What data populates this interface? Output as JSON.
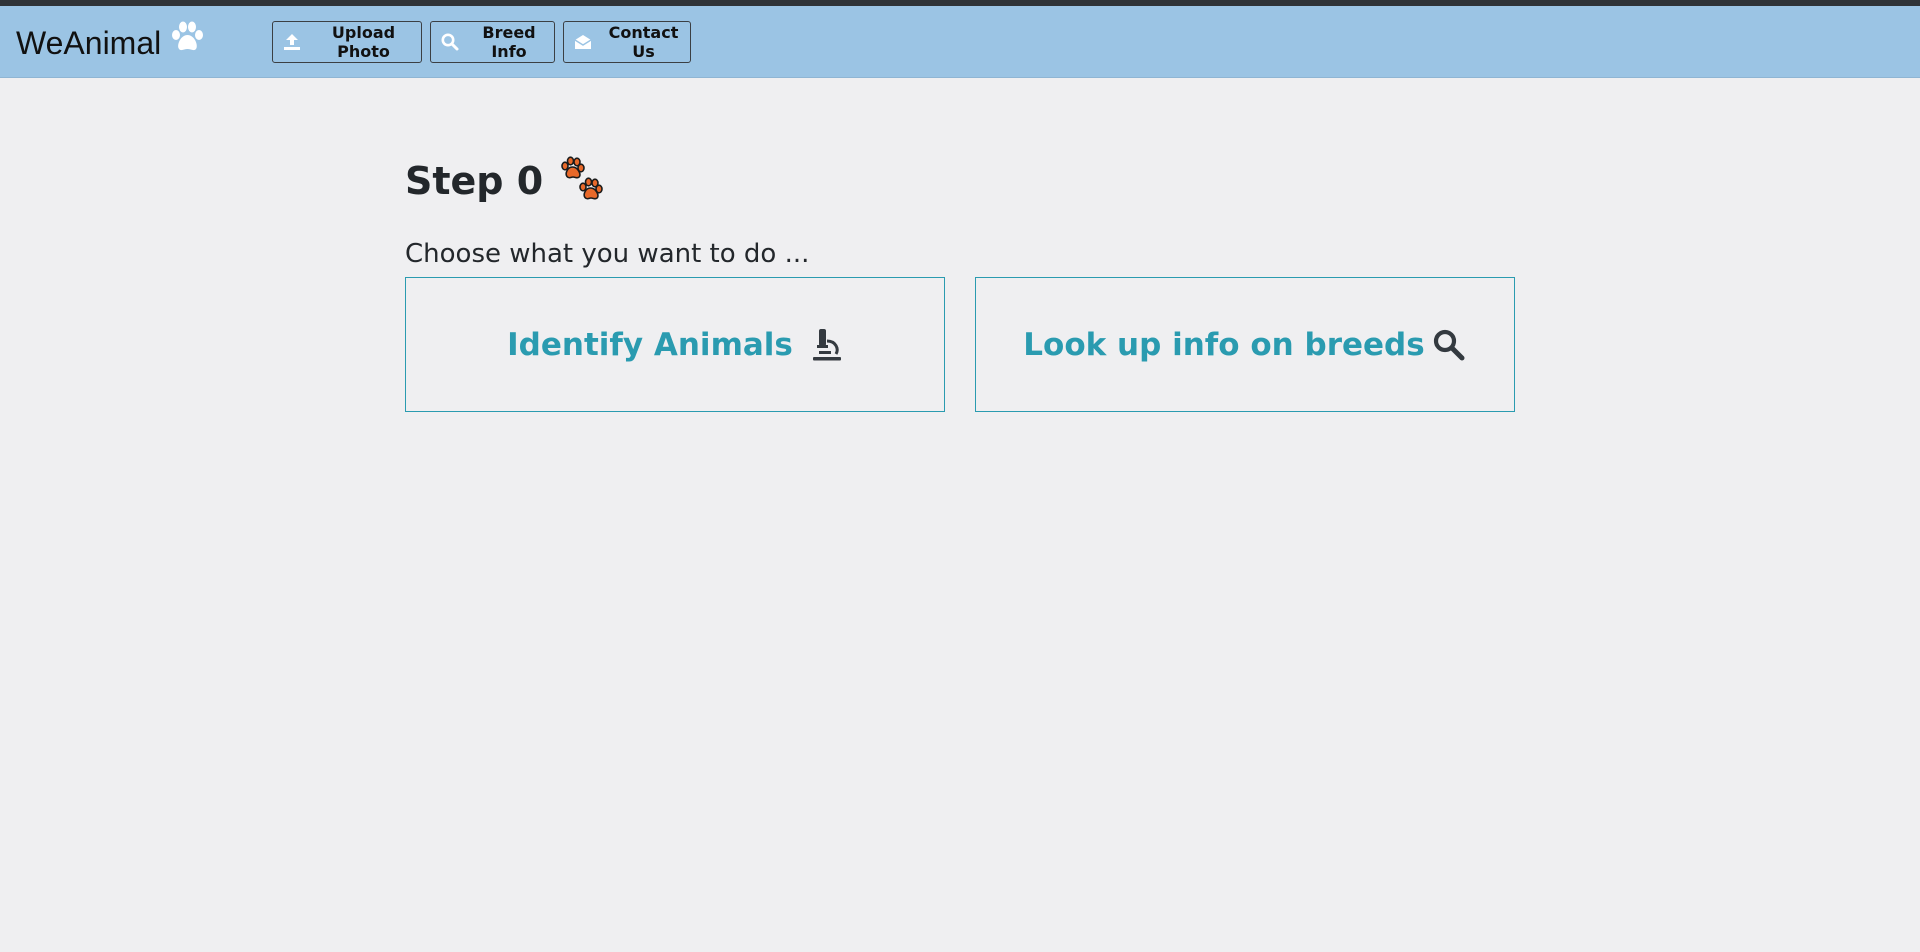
{
  "brand": {
    "name": "WeAnimal",
    "icon": "paw-icon"
  },
  "nav": {
    "buttons": [
      {
        "label": "Upload Photo",
        "icon": "upload-icon"
      },
      {
        "label": "Breed Info",
        "icon": "search-icon"
      },
      {
        "label": "Contact Us",
        "icon": "envelope-icon"
      }
    ]
  },
  "main": {
    "step_title": "Step 0",
    "step_icon": "paw-prints-icon",
    "subtitle": "Choose what you want to do ...",
    "options": [
      {
        "label": "Identify Animals",
        "icon": "microscope-icon"
      },
      {
        "label": "Look up info on breeds",
        "icon": "search-icon"
      }
    ]
  },
  "colors": {
    "navbar": "#9bc4e4",
    "background": "#efeff1",
    "accent": "#2a9bb0",
    "paw_orange": "#e8692a"
  }
}
